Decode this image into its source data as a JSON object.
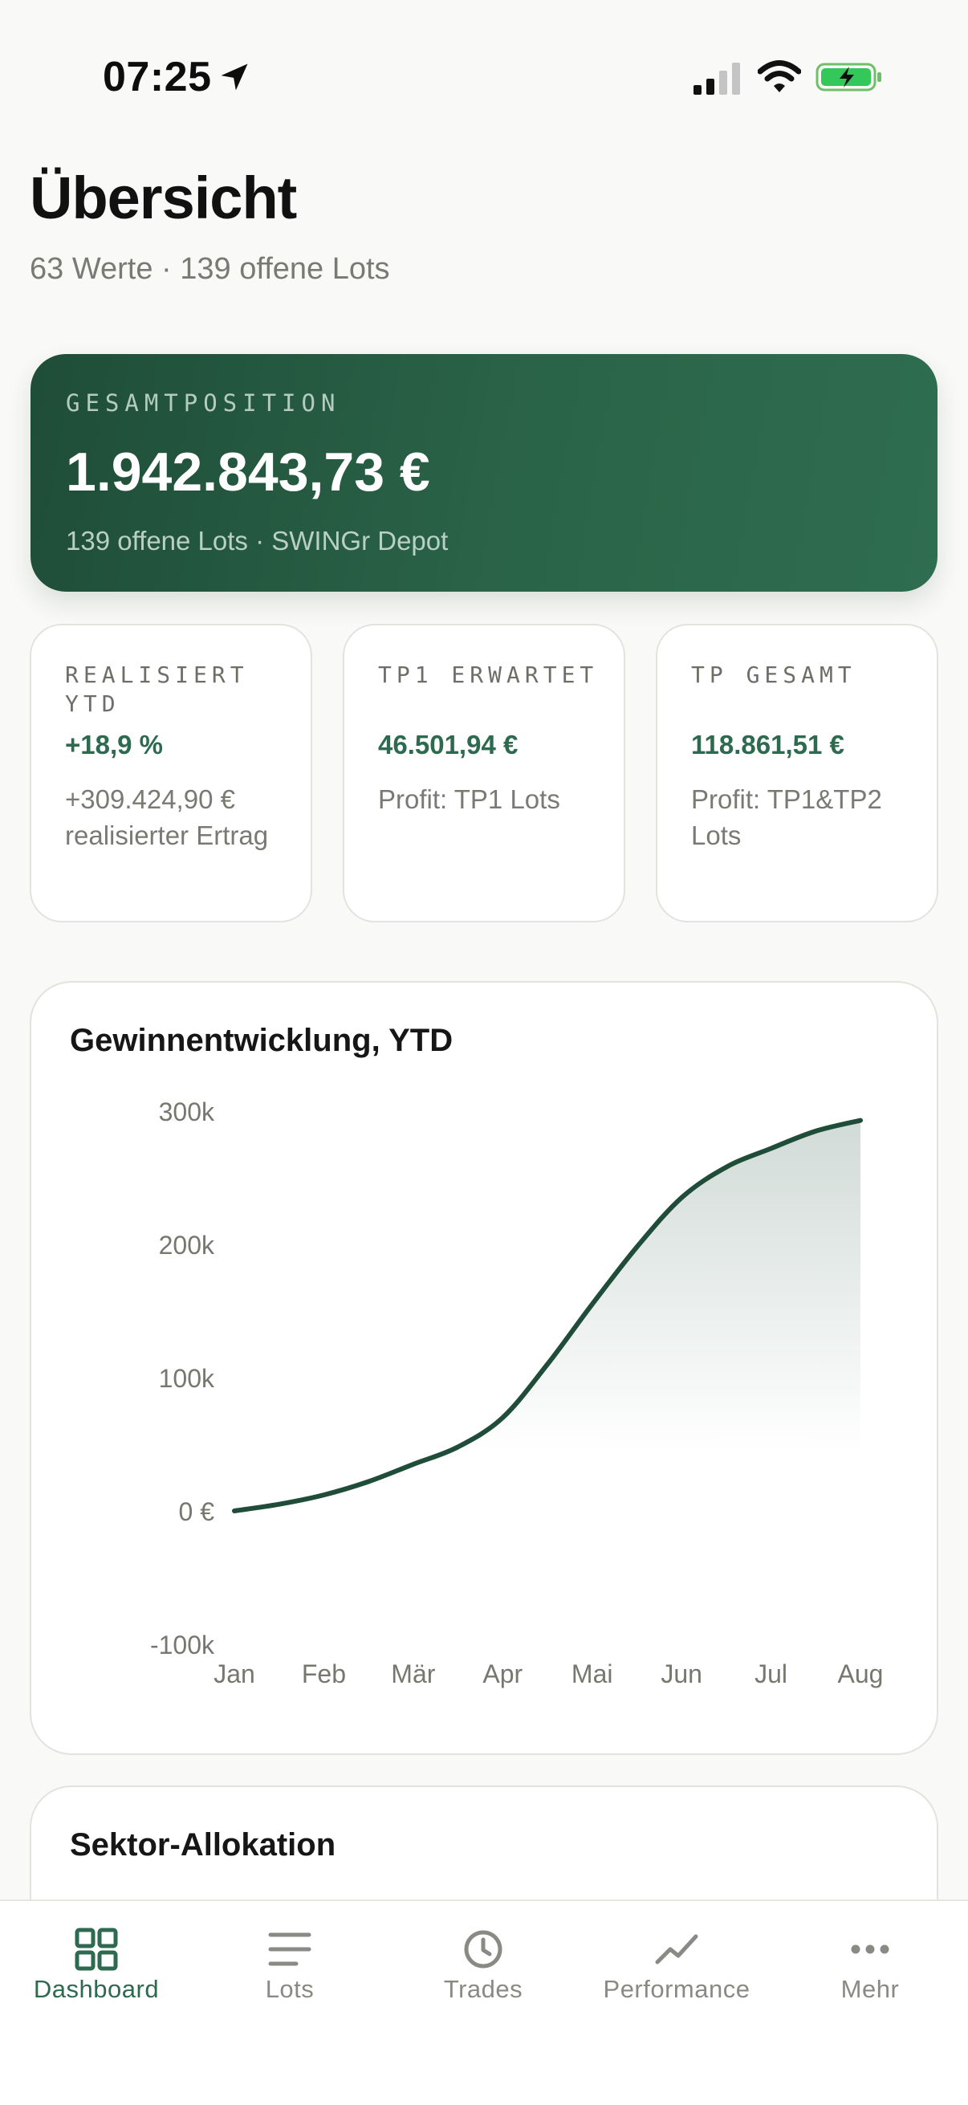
{
  "status_bar": {
    "time": "07:25",
    "icons": [
      "location-arrow-icon",
      "cellular-signal-icon",
      "wifi-icon",
      "battery-charging-icon"
    ]
  },
  "header": {
    "title": "Übersicht",
    "subtitle": "63 Werte · 139 offene Lots"
  },
  "hero": {
    "label": "GESAMTPOSITION",
    "value": "1.942.843,73 €",
    "sub": "139 offene Lots · SWINGr Depot"
  },
  "stats": [
    {
      "label": "REALISIERT YTD",
      "value": "+18,9 %",
      "desc": "+309.424,90 € realisierter Ertrag"
    },
    {
      "label": "TP1 ERWARTET",
      "value": "46.501,94 €",
      "desc": "Profit: TP1 Lots"
    },
    {
      "label": "TP GESAMT",
      "value": "118.861,51 €",
      "desc": "Profit: TP1&TP2 Lots"
    }
  ],
  "chart": {
    "title": "Gewinnentwicklung, YTD"
  },
  "chart_data": {
    "type": "area",
    "title": "Gewinnentwicklung, YTD",
    "xlabel": "",
    "ylabel": "",
    "categories": [
      "Jan",
      "Feb",
      "Mär",
      "Apr",
      "Mai",
      "Jun",
      "Jul",
      "Aug"
    ],
    "y_ticks": [
      300000,
      200000,
      100000,
      0,
      -100000
    ],
    "y_tick_labels": [
      "300k",
      "200k",
      "100k",
      "0 €",
      "-100k"
    ],
    "ylim": [
      -100000,
      300000
    ],
    "x": [
      0,
      0.5,
      1,
      1.5,
      2,
      2.5,
      3,
      3.5,
      4,
      4.5,
      5,
      5.5,
      6,
      6.5,
      7
    ],
    "values": [
      0,
      5000,
      12000,
      22000,
      35000,
      48000,
      70000,
      110000,
      155000,
      198000,
      235000,
      258000,
      272000,
      285000,
      293000
    ],
    "line_color": "#1f4d3a",
    "fill_color": "#2d5a48",
    "grid": false,
    "legend": "none"
  },
  "sector": {
    "title": "Sektor-Allokation"
  },
  "tabs": [
    {
      "label": "Dashboard",
      "icon": "grid-icon",
      "active": true
    },
    {
      "label": "Lots",
      "icon": "list-icon",
      "active": false
    },
    {
      "label": "Trades",
      "icon": "clock-icon",
      "active": false
    },
    {
      "label": "Performance",
      "icon": "trend-line-icon",
      "active": false
    },
    {
      "label": "Mehr",
      "icon": "more-dots-icon",
      "active": false
    }
  ],
  "colors": {
    "accent": "#2d6a4f",
    "hero_start": "#1f4d38",
    "hero_end": "#2f6d50",
    "background": "#f9f9f7"
  }
}
